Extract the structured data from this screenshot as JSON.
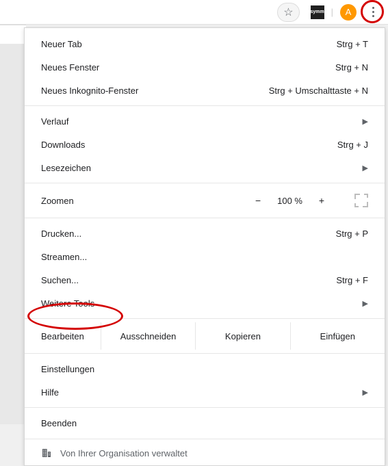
{
  "toolbar": {
    "avatar_letter": "A",
    "extension_label": "symm"
  },
  "menu": {
    "new_tab": {
      "label": "Neuer Tab",
      "shortcut": "Strg + T"
    },
    "new_window": {
      "label": "Neues Fenster",
      "shortcut": "Strg + N"
    },
    "new_incognito": {
      "label": "Neues Inkognito-Fenster",
      "shortcut": "Strg + Umschalttaste + N"
    },
    "history": {
      "label": "Verlauf"
    },
    "downloads": {
      "label": "Downloads",
      "shortcut": "Strg + J"
    },
    "bookmarks": {
      "label": "Lesezeichen"
    },
    "zoom": {
      "label": "Zoomen",
      "level": "100 %",
      "minus": "−",
      "plus": "+"
    },
    "print": {
      "label": "Drucken...",
      "shortcut": "Strg + P"
    },
    "cast": {
      "label": "Streamen..."
    },
    "find": {
      "label": "Suchen...",
      "shortcut": "Strg + F"
    },
    "more_tools": {
      "label": "Weitere Tools"
    },
    "edit": {
      "label": "Bearbeiten",
      "cut": "Ausschneiden",
      "copy": "Kopieren",
      "paste": "Einfügen"
    },
    "settings": {
      "label": "Einstellungen"
    },
    "help": {
      "label": "Hilfe"
    },
    "exit": {
      "label": "Beenden"
    },
    "managed": {
      "label": "Von Ihrer Organisation verwaltet"
    }
  }
}
